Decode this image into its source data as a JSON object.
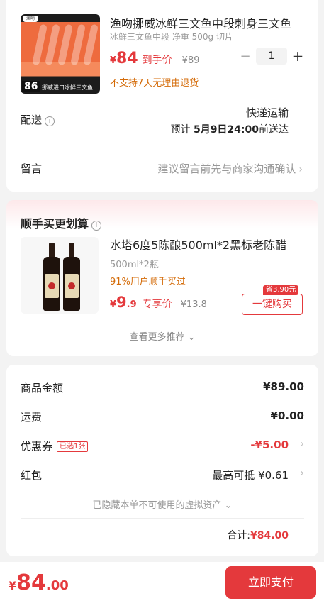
{
  "product": {
    "title": "渔吻挪威冰鲜三文鱼中段刺身三文鱼",
    "spec": "冰鲜三文鱼中段 净重 500g 切片",
    "price_currency": "¥",
    "price": "84",
    "price_tag": "到手价",
    "original_price": "¥89",
    "quantity": "1",
    "return_policy": "不支持7天无理由退货",
    "image_badge": "86",
    "image_logo": "渔吻",
    "image_text": "挪威进口冰鲜三文鱼"
  },
  "delivery": {
    "label": "配送",
    "method": "快递运输",
    "eta_prefix": "预计",
    "eta_date": "5月9日24:00",
    "eta_suffix": "前送达"
  },
  "message": {
    "label": "留言",
    "placeholder": "建议留言前先与商家沟通确认"
  },
  "recommend": {
    "section_title": "顺手买更划算",
    "title": "水塔6度5陈酿500ml*2黑标老陈醋",
    "spec": "500ml*2瓶",
    "bought_text": "91%用户顺手买过",
    "price_currency": "¥",
    "price_int": "9",
    "price_dec": ".9",
    "price_tag": "专享价",
    "original_price": "¥13.8",
    "save_tag": "省3.90元",
    "buy_label": "一键购买",
    "more_label": "查看更多推荐"
  },
  "summary": {
    "goods_label": "商品金额",
    "goods_value": "¥89.00",
    "shipping_label": "运费",
    "shipping_value": "¥0.00",
    "coupon_label": "优惠券",
    "coupon_tag": "已选1张",
    "coupon_value": "-¥5.00",
    "redpacket_label": "红包",
    "redpacket_value": "最高可抵 ¥0.61",
    "hidden_assets": "已隐藏本单不可使用的虚拟资产",
    "total_label": "合计:",
    "total_value": "¥84.00"
  },
  "footer": {
    "currency": "¥",
    "amount_int": "84",
    "amount_dec": ".00",
    "pay_label": "立即支付"
  },
  "colors": {
    "accent": "#e4393c",
    "warning": "#d46b08",
    "background": "#f3f3f3"
  },
  "icons": [
    "info-icon",
    "chevron-right-icon",
    "chevron-down-icon",
    "minus-icon",
    "plus-icon"
  ]
}
